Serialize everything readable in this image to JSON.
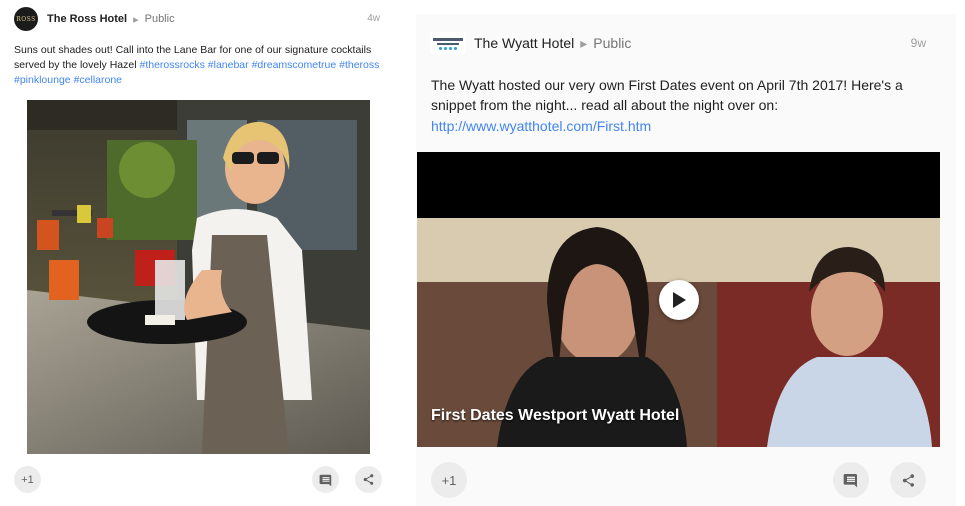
{
  "posts": [
    {
      "author": "The Ross Hotel",
      "avatar_text": "ROSS",
      "audience": "Public",
      "age": "4w",
      "text_prefix": "Suns out shades out! Call into the Lane Bar for one of our signature cocktails served by the lovely Hazel",
      "hashtags": [
        "#therossrocks",
        "#lanebar",
        "#dreamscometrue",
        "#theross",
        "#pinklounge",
        "#cellarone"
      ],
      "plus_one_label": "+1",
      "comment_icon": "comment-icon",
      "share_icon": "share-icon"
    },
    {
      "author": "The Wyatt Hotel",
      "audience": "Public",
      "age": "9w",
      "text": "The Wyatt hosted our very own First Dates event on April 7th 2017! Here's a snippet from the night... read all about the night over on:",
      "link": "http://www.wyatthotel.com/First.htm",
      "video_title": "First Dates Westport Wyatt Hotel",
      "plus_one_label": "+1",
      "comment_icon": "comment-icon",
      "share_icon": "share-icon",
      "play_icon": "play-icon"
    }
  ],
  "colors": {
    "link": "#4285f4",
    "text": "#212121",
    "muted": "#757575",
    "button_bg": "#ececec"
  }
}
